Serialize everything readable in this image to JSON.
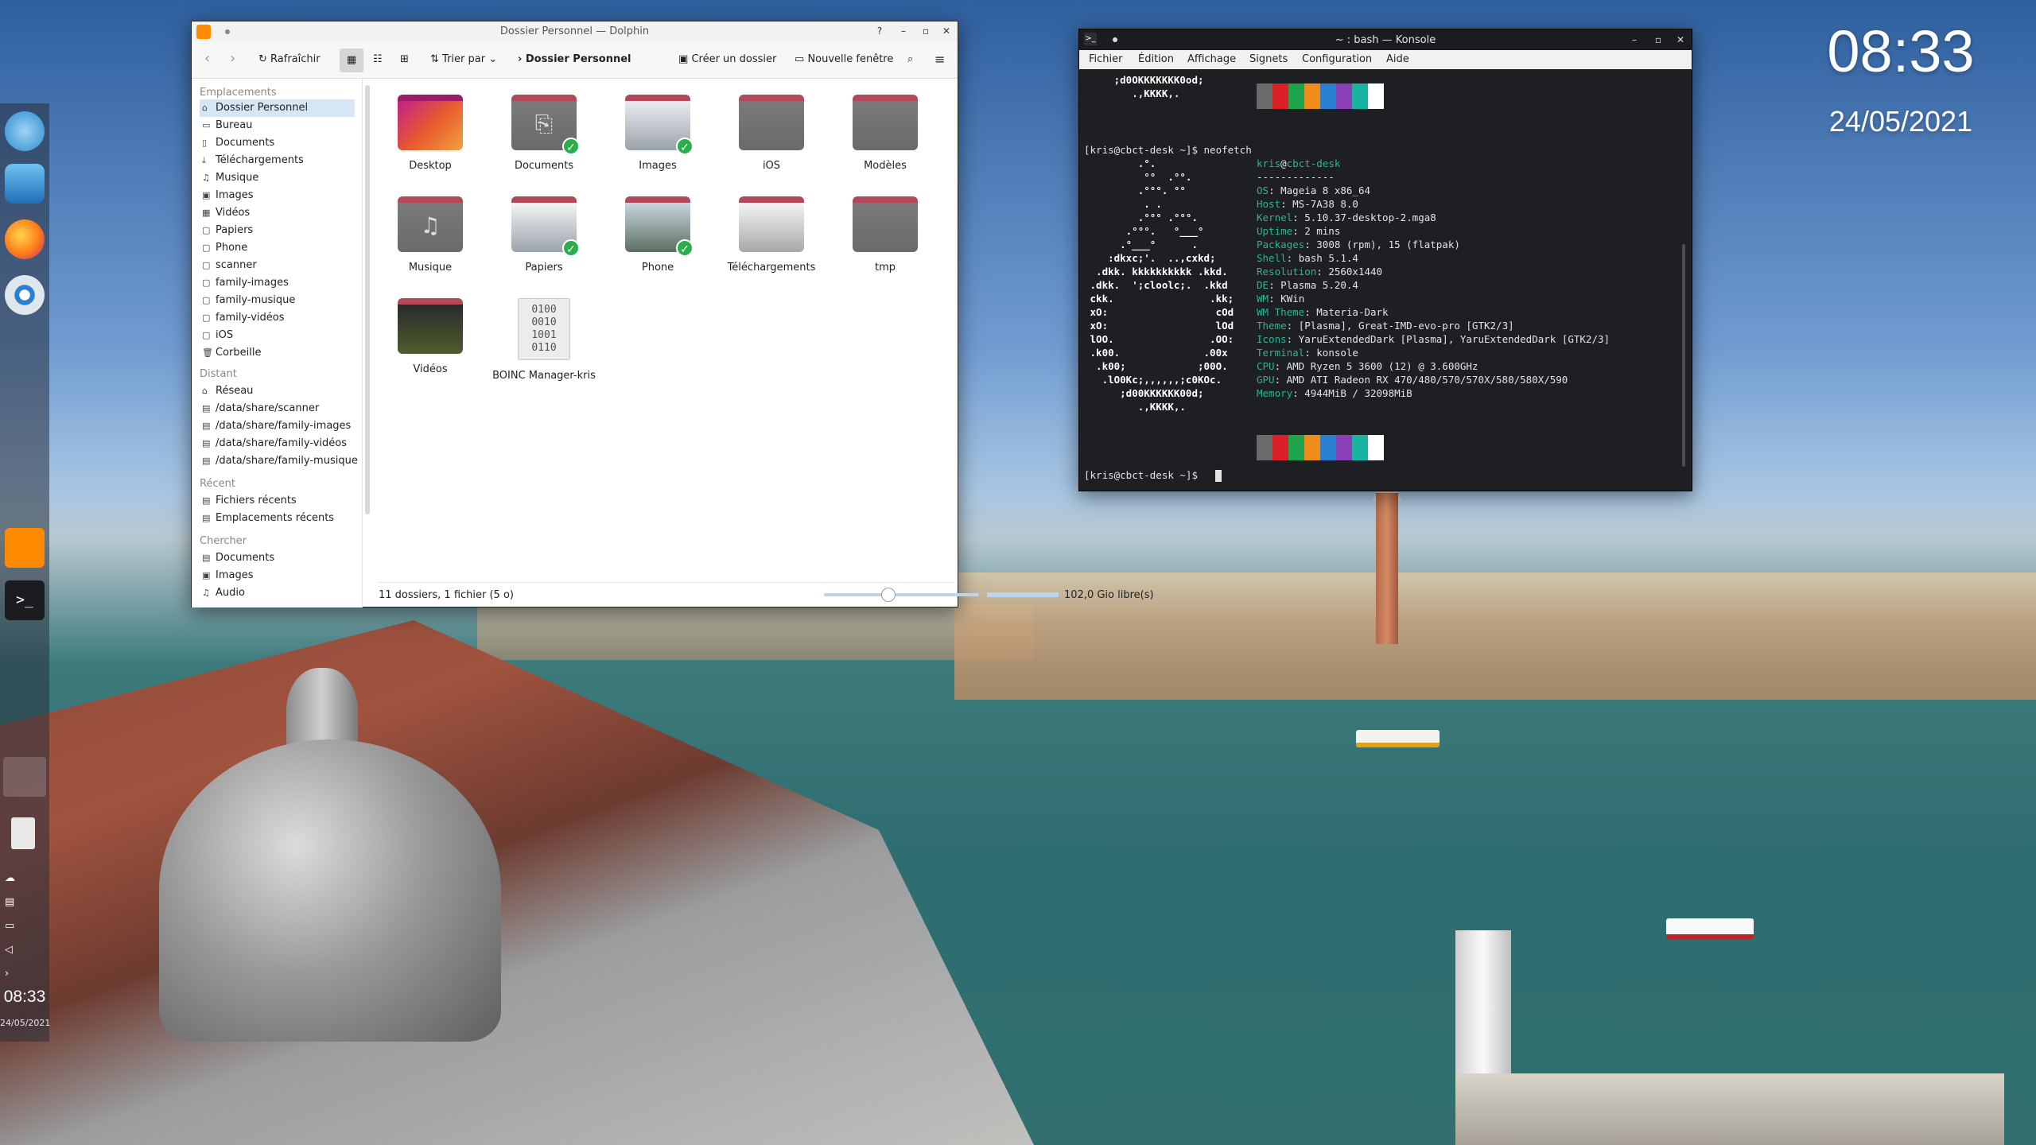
{
  "desktop": {
    "clock": "08:33",
    "date": "24/05/2021"
  },
  "panel": {
    "clock": "08:33",
    "date": "24/05/2021"
  },
  "dolphin": {
    "title": "Dossier Personnel — Dolphin",
    "help_btn": "?",
    "toolbar": {
      "refresh": "Rafraîchir",
      "sort": "Trier par",
      "breadcrumb": "Dossier Personnel",
      "new_folder": "Créer un dossier",
      "new_window": "Nouvelle fenêtre"
    },
    "places": {
      "section_places": "Emplacements",
      "items": [
        "Dossier Personnel",
        "Bureau",
        "Documents",
        "Téléchargements",
        "Musique",
        "Images",
        "Vidéos",
        "Papiers",
        "Phone",
        "scanner",
        "family-images",
        "family-musique",
        "family-vidéos",
        "iOS",
        "Corbeille"
      ],
      "section_remote": "Distant",
      "remote": [
        "Réseau",
        "/data/share/scanner",
        "/data/share/family-images",
        "/data/share/family-vidéos",
        "/data/share/family-musique"
      ],
      "section_recent": "Récent",
      "recent": [
        "Fichiers récents",
        "Emplacements récents"
      ],
      "section_search": "Chercher",
      "search": [
        "Documents",
        "Images",
        "Audio"
      ]
    },
    "files": [
      {
        "name": "Desktop"
      },
      {
        "name": "Documents"
      },
      {
        "name": "Images"
      },
      {
        "name": "iOS"
      },
      {
        "name": "Modèles"
      },
      {
        "name": "Musique"
      },
      {
        "name": "Papiers"
      },
      {
        "name": "Phone"
      },
      {
        "name": "Téléchargements"
      },
      {
        "name": "tmp"
      },
      {
        "name": "Vidéos"
      },
      {
        "name": "BOINC Manager-kris"
      }
    ],
    "boinc_glyph": "0100\n0010\n1001\n0110",
    "status": {
      "summary": "11 dossiers, 1 fichier (5 o)",
      "free": "102,0 Gio libre(s)",
      "zoom_fraction": 0.35
    }
  },
  "konsole": {
    "title": "~ : bash — Konsole",
    "menu": [
      "Fichier",
      "Édition",
      "Affichage",
      "Signets",
      "Configuration",
      "Aide"
    ],
    "prompt": "[kris@cbct-desk ~]$",
    "command": "neofetch",
    "top_art": [
      "     ;d0OKKKKKKK0od;",
      "        .,KKKK,."
    ],
    "art": [
      "         .°.",
      "          °°  .°°.",
      "         .°°°. °°",
      "          . .",
      "         .°°° .°°°.",
      "       .°°°.   °___°",
      "      .°___°      .",
      "    :dkxc;'.  ..,cxkd;",
      "  .dkk. kkkkkkkkkk .kkd.",
      " .dkk.  ';cloolc;.  .kkd",
      " ckk.                .kk;",
      " xO:                  cOd",
      " xO:                  lOd",
      " lOO.                .OO:",
      " .k00.              .00x",
      "  .k00;            ;00O.",
      "   .lO0Kc;,,,,,,;c0KOc.",
      "      ;d00KKKKKK00d;",
      "         .,KKKK,."
    ],
    "user": "kris",
    "at": "@",
    "host": "cbct-desk",
    "separator": "-------------",
    "info": [
      {
        "k": "OS",
        "v": "Mageia 8 x86_64"
      },
      {
        "k": "Host",
        "v": "MS-7A38 8.0"
      },
      {
        "k": "Kernel",
        "v": "5.10.37-desktop-2.mga8"
      },
      {
        "k": "Uptime",
        "v": "2 mins"
      },
      {
        "k": "Packages",
        "v": "3008 (rpm), 15 (flatpak)"
      },
      {
        "k": "Shell",
        "v": "bash 5.1.4"
      },
      {
        "k": "Resolution",
        "v": "2560x1440"
      },
      {
        "k": "DE",
        "v": "Plasma 5.20.4"
      },
      {
        "k": "WM",
        "v": "KWin"
      },
      {
        "k": "WM Theme",
        "v": "Materia-Dark"
      },
      {
        "k": "Theme",
        "v": "[Plasma], Great-IMD-evo-pro [GTK2/3]"
      },
      {
        "k": "Icons",
        "v": "YaruExtendedDark [Plasma], YaruExtendedDark [GTK2/3]"
      },
      {
        "k": "Terminal",
        "v": "konsole"
      },
      {
        "k": "CPU",
        "v": "AMD Ryzen 5 3600 (12) @ 3.600GHz"
      },
      {
        "k": "GPU",
        "v": "AMD ATI Radeon RX 470/480/570/570X/580/580X/590"
      },
      {
        "k": "Memory",
        "v": "4944MiB / 32098MiB"
      }
    ],
    "palette": [
      "#6b6b6b",
      "#d92027",
      "#1ea34a",
      "#f08c1a",
      "#2a7fd0",
      "#8a3fb5",
      "#19b3a2",
      "#ffffff"
    ]
  }
}
